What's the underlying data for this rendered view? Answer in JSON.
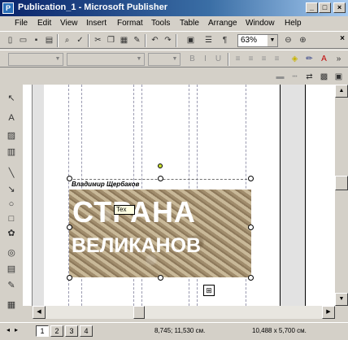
{
  "window": {
    "title": "Publication_1 - Microsoft Publisher",
    "minimize": "_",
    "restore": "□",
    "close": "×"
  },
  "menu": {
    "items": [
      "File",
      "Edit",
      "View",
      "Insert",
      "Format",
      "Tools",
      "Table",
      "Arrange",
      "Window",
      "Help"
    ],
    "doc_close": "×"
  },
  "toolbar": {
    "zoom": "63%",
    "icons": [
      "new-icon",
      "open-icon",
      "save-icon",
      "print-icon",
      "print-preview-icon",
      "spelling-icon",
      "cut-icon",
      "copy-icon",
      "paste-icon",
      "format-painter-icon",
      "insert-picture-icon",
      "columns-icon",
      "paragraph-icon",
      "zoom-out-icon",
      "zoom-in-icon"
    ]
  },
  "document": {
    "author": "Владимир Щербаков",
    "title_line1": "СТРАНА",
    "title_line2": "ВЕЛИКАНОВ",
    "tooltip": "Tex"
  },
  "status": {
    "pages": [
      "1",
      "2",
      "3",
      "4"
    ],
    "active_page": "1",
    "position": "8,745; 11,530 см.",
    "size": "10,488 x 5,700 см."
  },
  "colors": {
    "title_bar_start": "#0a246a",
    "title_bar_end": "#a6caf0",
    "chrome": "#d4d0c8",
    "banner_text": "#ffffff"
  }
}
